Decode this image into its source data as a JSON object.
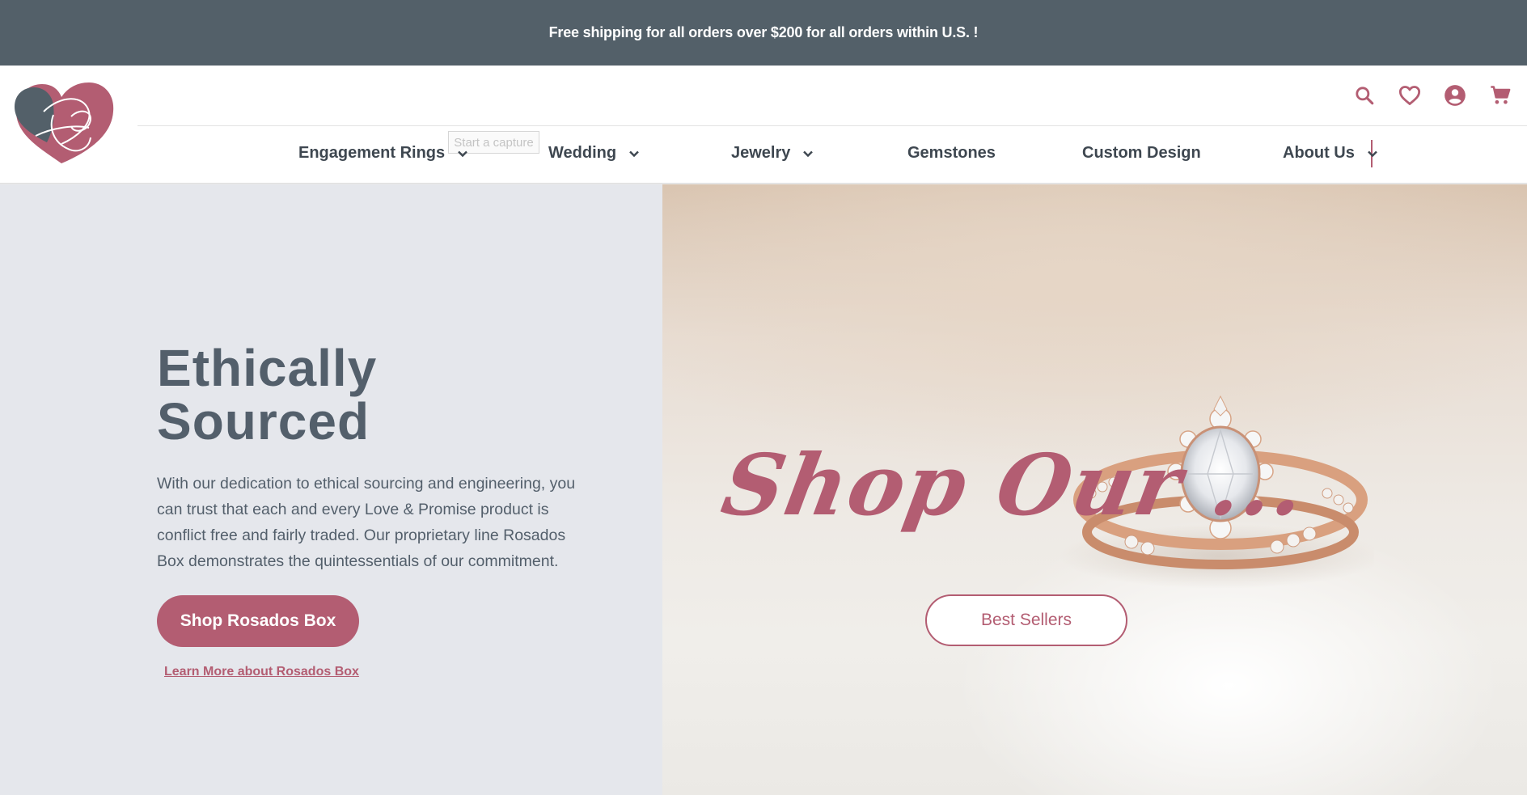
{
  "announcement": {
    "text": "Free shipping for all orders over $200 for all orders within U.S. !"
  },
  "capture_tooltip": "Start a capture",
  "header": {
    "icons": [
      "search-icon",
      "heart-icon",
      "account-icon",
      "cart-icon"
    ]
  },
  "nav": {
    "items": [
      {
        "label": "Engagement Rings",
        "has_dropdown": true
      },
      {
        "label": "Wedding",
        "has_dropdown": true
      },
      {
        "label": "Jewelry",
        "has_dropdown": true
      },
      {
        "label": "Gemstones",
        "has_dropdown": false
      },
      {
        "label": "Custom Design",
        "has_dropdown": false
      },
      {
        "label": "About Us",
        "has_dropdown": true
      }
    ]
  },
  "hero": {
    "title_line1": "Ethically",
    "title_line2": "Sourced",
    "body": "With our dedication to ethical sourcing and engineering, you can trust that each and every Love & Promise product is conflict free and fairly traded. Our proprietary line Rosados Box demonstrates the quintessentials of our commitment.",
    "primary_button": "Shop Rosados Box",
    "learn_link": "Learn More about Rosados Box",
    "promo_script": "Shop Our ...",
    "secondary_button": "Best Sellers"
  },
  "colors": {
    "brand": "#b35d72",
    "slate": "#536069",
    "hero_left_bg": "#e5e7ec"
  }
}
